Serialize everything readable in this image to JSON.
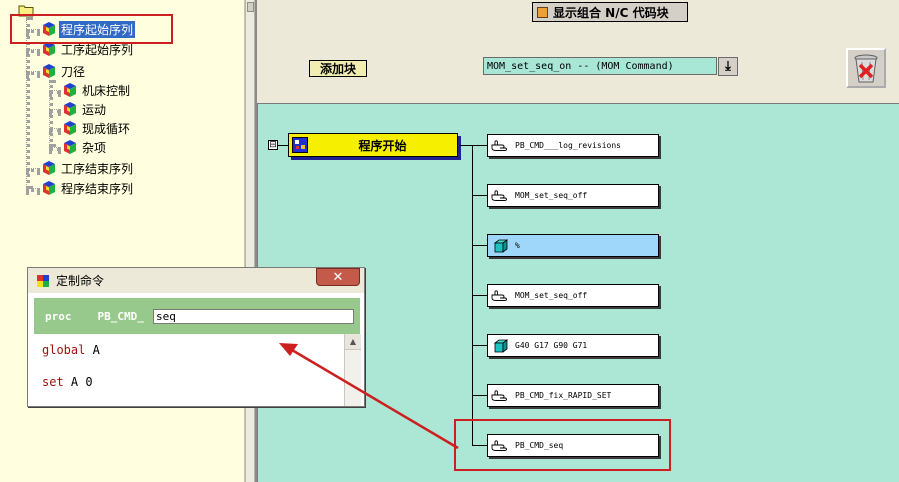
{
  "tree": {
    "items": [
      {
        "label": "程序起始序列",
        "selected": true
      },
      {
        "label": "工序起始序列"
      },
      {
        "label": "刀径"
      },
      {
        "label": "机床控制"
      },
      {
        "label": "运动"
      },
      {
        "label": "现成循环"
      },
      {
        "label": "杂项"
      },
      {
        "label": "工序结束序列"
      },
      {
        "label": "程序结束序列"
      }
    ]
  },
  "toolbar": {
    "title": "显示组合 N/C 代码块",
    "add_block_label": "添加块",
    "command_selected": "MOM_set_seq_on -- (MOM Command)",
    "dropdown_glyph": "⤓"
  },
  "canvas": {
    "start_block_label": "程序开始",
    "collapse_glyph": "⊟",
    "blocks": [
      {
        "label": "PB_CMD___log_revisions",
        "icon": "hand-pointer-icon"
      },
      {
        "label": "MOM_set_seq_off",
        "icon": "hand-pointer-icon"
      },
      {
        "label": "%",
        "icon": "cube-icon"
      },
      {
        "label": "MOM_set_seq_off",
        "icon": "hand-pointer-icon"
      },
      {
        "label": "G40 G17 G90 G71",
        "icon": "cube-icon"
      },
      {
        "label": "PB_CMD_fix_RAPID_SET",
        "icon": "hand-pointer-icon"
      },
      {
        "label": "PB_CMD_seq",
        "icon": "hand-pointer-icon"
      }
    ]
  },
  "popup": {
    "title": "定制命令",
    "close_glyph": "✕",
    "proc_keyword": "proc",
    "proc_prefix": "PB_CMD_",
    "proc_name": "seq",
    "code": [
      {
        "keyword": "global",
        "rest": " A"
      },
      {
        "keyword": "set",
        "rest": " A 0"
      }
    ]
  },
  "colors": {
    "tree_bg": "#ffffdf",
    "canvas_bg": "#abe7d4",
    "start_block": "#f6f000",
    "highlight_block": "#9fd7fb",
    "annotation_red": "#cc2020",
    "proc_bar": "#97c98c"
  }
}
